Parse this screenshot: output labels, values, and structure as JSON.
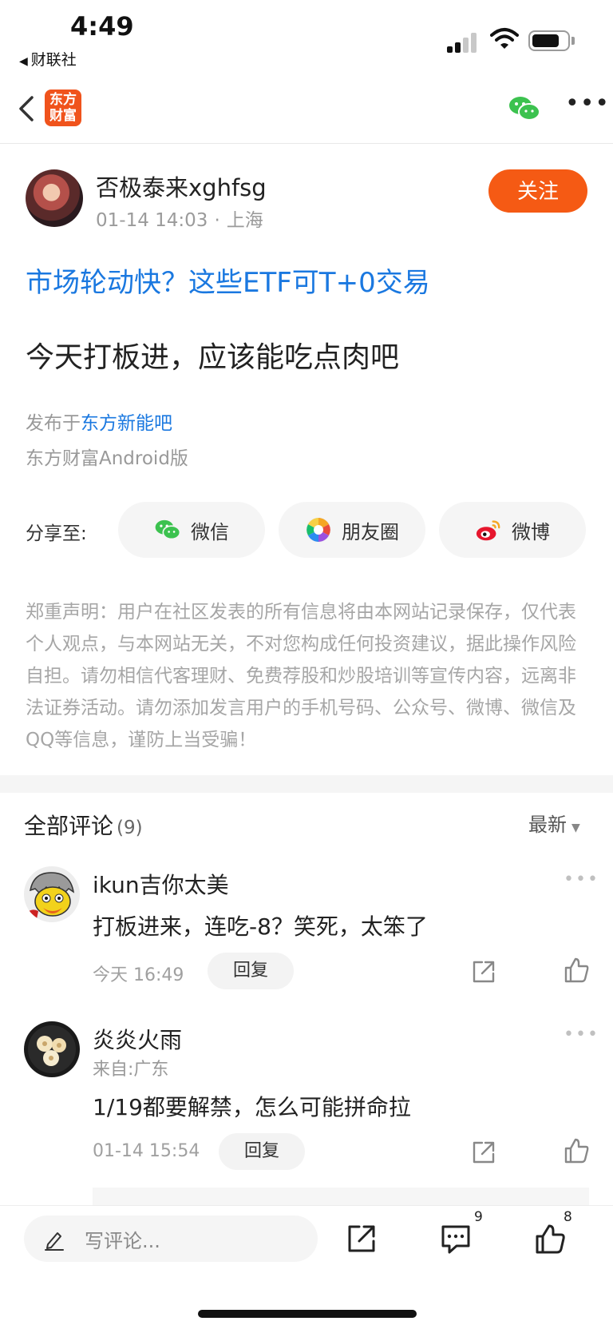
{
  "status_bar": {
    "time": "4:49",
    "back_app": "财联社",
    "back_icon": "back-triangle-icon",
    "battery_level": 0.8
  },
  "nav": {
    "app_logo_line1": "东方",
    "app_logo_line2": "财富",
    "app_logo_color": "#f0531c"
  },
  "author": {
    "name": "否极泰来xghfsg",
    "date": "01-14 14:03",
    "dot": "·",
    "location": "上海",
    "follow_label": "关注"
  },
  "post": {
    "promo_link": "市场轮动快？这些ETF可T+0交易",
    "body": "今天打板进，应该能吃点肉吧",
    "published_prefix": "发布于",
    "published_forum": "东方新能吧",
    "platform": "东方财富Android版"
  },
  "share": {
    "label": "分享至:",
    "options": [
      "微信",
      "朋友圈",
      "微博"
    ]
  },
  "disclaimer": "郑重声明：用户在社区发表的所有信息将由本网站记录保存，仅代表个人观点，与本网站无关，不对您构成任何投资建议，据此操作风险自担。请勿相信代客理财、免费荐股和炒股培训等宣传内容，远离非法证券活动。请勿添加发言用户的手机号码、公众号、微博、微信及QQ等信息，谨防上当受骗！",
  "comments": {
    "title": "全部评论",
    "count": "(9)",
    "sort_label": "最新",
    "items": [
      {
        "name": "ikun吉你太美",
        "text": "打板进来，连吃-8？笑死，太笨了",
        "time": "今天 16:49",
        "reply_label": "回复"
      },
      {
        "name": "炎炎火雨",
        "location": "来自:广东",
        "text": "1/19都要解禁，怎么可能拼命拉",
        "time": "01-14 15:54",
        "reply_label": "回复"
      }
    ]
  },
  "bottom_bar": {
    "input_placeholder": "写评论...",
    "comment_count": "9",
    "like_count": "8"
  },
  "colors": {
    "accent_orange": "#f55a14",
    "link_blue": "#1a78e0",
    "wechat_green": "#3cc24f"
  }
}
